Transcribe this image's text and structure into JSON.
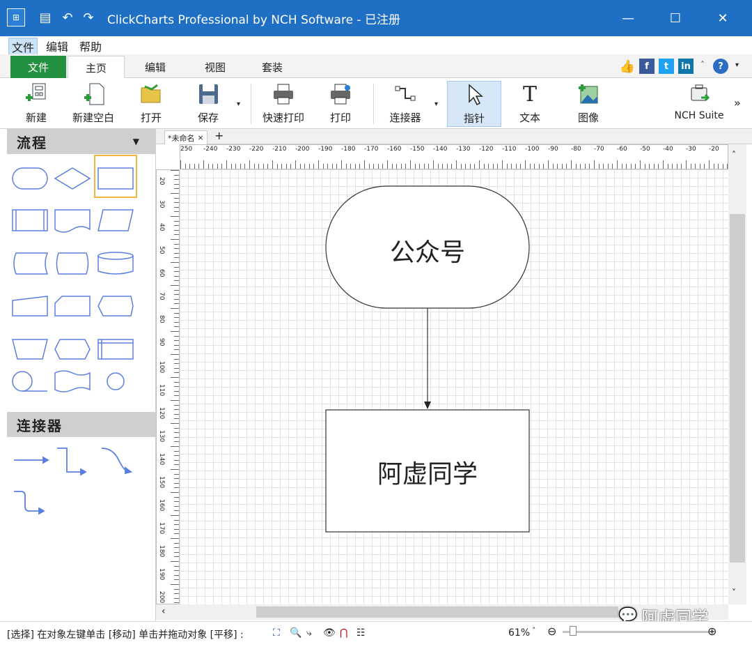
{
  "window": {
    "title": "ClickCharts Professional by NCH Software - 已注册",
    "minimize": "—",
    "maximize": "☐",
    "close": "✕"
  },
  "menu": [
    "文件",
    "编辑",
    "帮助"
  ],
  "ribbon_tabs": [
    "文件",
    "主页",
    "编辑",
    "视图",
    "套装"
  ],
  "ribbon_buttons": {
    "new": "新建",
    "new_blank": "新建空白",
    "open": "打开",
    "save": "保存",
    "quick_print": "快速打印",
    "print": "打印",
    "connector": "连接器",
    "pointer": "指针",
    "text": "文本",
    "image": "图像",
    "nch_suite": "NCH Suite",
    "more": "»"
  },
  "left_panel": {
    "section1": "流程",
    "section2": "连接器"
  },
  "doc_tab": {
    "label": "*未命名",
    "close": "×",
    "add": "+"
  },
  "h_ruler_labels": [
    "250",
    "-240",
    "-230",
    "-220",
    "-210",
    "-200",
    "-190",
    "-180",
    "-170",
    "-160",
    "-150",
    "-140",
    "-130",
    "-120",
    "-110",
    "-100",
    "-90",
    "-80",
    "-70",
    "-60",
    "-50",
    "-40",
    "-30",
    "-20"
  ],
  "v_ruler_labels": [
    "20",
    "30",
    "40",
    "50",
    "60",
    "70",
    "80",
    "90",
    "100",
    "110",
    "120",
    "130",
    "140",
    "150",
    "160",
    "170",
    "180",
    "190",
    "200"
  ],
  "diagram": {
    "terminator_text": "公众号",
    "process_text": "阿虚同学"
  },
  "statusbar": {
    "hint": "[选择] 在对象左键单击 [移动] 单击并拖动对象 [平移] :",
    "zoom": "61%",
    "zoom_caret": "˄",
    "zoom_out": "⊖",
    "zoom_in": "⊕"
  },
  "watermark": "阿虚同学",
  "colors": {
    "titlebar": "#1f6fc4",
    "file_tab": "#23913f",
    "shape_stroke": "#5b7fe0"
  }
}
